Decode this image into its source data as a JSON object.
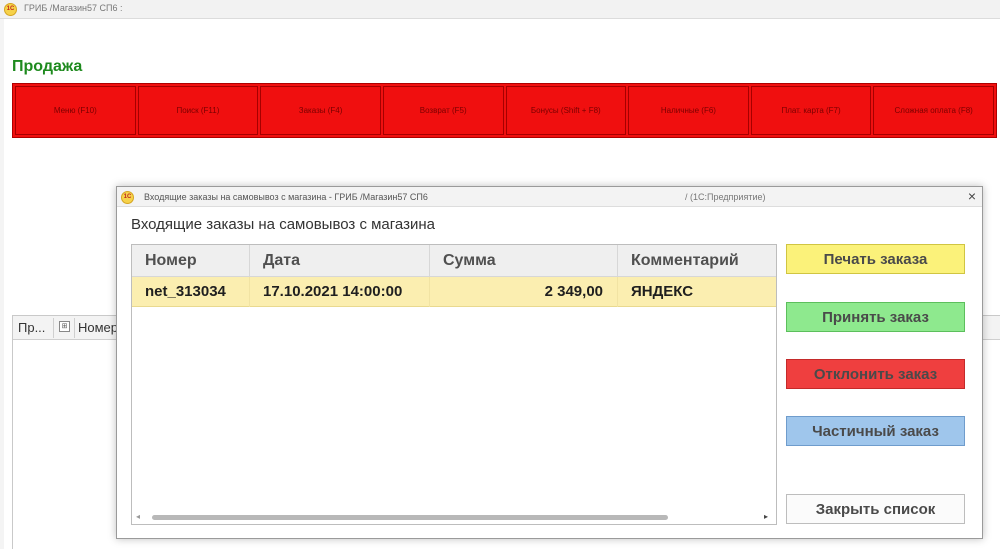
{
  "main_window": {
    "title": "ГРИБ /Магазин57 СП6 :",
    "logo": "1С"
  },
  "page_title": "Продажа",
  "toolbar": {
    "buttons": [
      "Меню (F10)",
      "Поиск (F11)",
      "Заказы (F4)",
      "Возврат (F5)",
      "Бонусы (Shift + F8)",
      "Наличные (F6)",
      "Плат. карта (F7)",
      "Сложная оплата (F8)"
    ]
  },
  "background_table": {
    "col_pr": "Пр...",
    "col_icon": "⊞",
    "col_num": "Номер"
  },
  "dialog": {
    "title": "Входящие заказы на самовывоз с магазина - ГРИБ /Магазин57 СП6",
    "title_suffix": "/  (1С:Предприятие)",
    "close_symbol": "×",
    "heading": "Входящие заказы на самовывоз с магазина",
    "grid": {
      "columns": [
        "Номер",
        "Дата",
        "Сумма",
        "Комментарий"
      ],
      "rows": [
        [
          "net_313034",
          "17.10.2021 14:00:00",
          "2 349,00",
          "ЯНДЕКС"
        ]
      ],
      "scroll_left": "◂",
      "scroll_right": "▸"
    },
    "buttons": {
      "print": "Печать заказа",
      "accept": "Принять заказ",
      "reject": "Отклонить заказ",
      "partial": "Частичный заказ",
      "close_list": "Закрыть список"
    }
  },
  "colors": {
    "toolbar_red": "#f01010",
    "title_green": "#1e8a1e",
    "selected_row": "#fbeeb0",
    "print_yellow": "#fbf27a",
    "accept_green": "#8ee98e",
    "reject_red": "#ef3f3f",
    "partial_blue": "#9fc6ec"
  }
}
